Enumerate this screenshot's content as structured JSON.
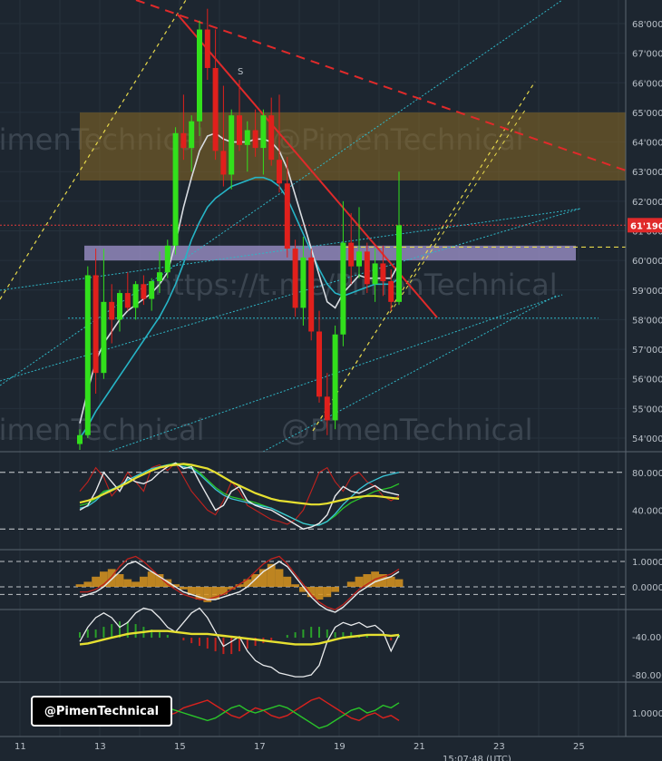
{
  "chart_data": {
    "type": "candlestick",
    "watermarks": [
      "PimenTechnical",
      "@PimenTechnical",
      "https://t.me/PimenTechnical"
    ],
    "annotation_label": "S",
    "current_price_label": "61'190",
    "price_axis": {
      "ylim": [
        53500,
        68500
      ],
      "ticks": [
        "68'000",
        "67'000",
        "66'000",
        "65'000",
        "64'000",
        "63'000",
        "62'000",
        "61'000",
        "60'000",
        "59'000",
        "58'000",
        "57'000",
        "56'000",
        "55'000",
        "54'000"
      ]
    },
    "date_axis": {
      "ticks": [
        "11",
        "13",
        "15",
        "17",
        "19",
        "21",
        "23",
        "25"
      ],
      "footer": "15:07:48 (UTC)"
    },
    "zones": [
      {
        "name": "supply",
        "from": 62700,
        "to": 65000,
        "color": "#8a6a25"
      },
      {
        "name": "support",
        "from": 60000,
        "to": 60500,
        "color": "#9a8fc6"
      }
    ],
    "candles_ohlc": [
      [
        53800,
        54300,
        53600,
        54100
      ],
      [
        54100,
        59800,
        54000,
        59500
      ],
      [
        59500,
        60400,
        55500,
        56200
      ],
      [
        56200,
        60400,
        56000,
        58600
      ],
      [
        58600,
        59200,
        57200,
        58000
      ],
      [
        58000,
        59000,
        57600,
        58900
      ],
      [
        58900,
        59600,
        58300,
        58400
      ],
      [
        58400,
        59300,
        58000,
        59200
      ],
      [
        59200,
        59500,
        58500,
        58700
      ],
      [
        58700,
        59400,
        58300,
        59300
      ],
      [
        59300,
        60300,
        58900,
        59600
      ],
      [
        59600,
        60700,
        59400,
        60500
      ],
      [
        60500,
        64500,
        60200,
        64300
      ],
      [
        64300,
        65600,
        63400,
        63800
      ],
      [
        63800,
        64900,
        63000,
        64700
      ],
      [
        64700,
        68100,
        64200,
        67800
      ],
      [
        67800,
        68500,
        66100,
        66500
      ],
      [
        66500,
        67800,
        63400,
        63700
      ],
      [
        63700,
        65900,
        62500,
        62900
      ],
      [
        62900,
        65100,
        62400,
        64900
      ],
      [
        64900,
        66100,
        63700,
        63900
      ],
      [
        63900,
        64700,
        63000,
        64400
      ],
      [
        64400,
        65100,
        63500,
        63800
      ],
      [
        63800,
        65100,
        62900,
        64900
      ],
      [
        64900,
        65500,
        63200,
        63400
      ],
      [
        63400,
        65600,
        62300,
        62600
      ],
      [
        62600,
        63500,
        60100,
        60400
      ],
      [
        60400,
        60700,
        58100,
        58400
      ],
      [
        58400,
        60800,
        57800,
        60100
      ],
      [
        60100,
        60400,
        57300,
        57600
      ],
      [
        57600,
        58300,
        55200,
        55400
      ],
      [
        55400,
        56200,
        54100,
        54600
      ],
      [
        54600,
        57800,
        54300,
        57500
      ],
      [
        57500,
        62000,
        57100,
        60600
      ],
      [
        60600,
        61600,
        59200,
        59800
      ],
      [
        59800,
        61800,
        59400,
        60300
      ],
      [
        60300,
        60600,
        58900,
        59200
      ],
      [
        59200,
        60400,
        58600,
        59900
      ],
      [
        59900,
        60500,
        58800,
        59300
      ],
      [
        59300,
        59700,
        58300,
        58600
      ],
      [
        58600,
        63000,
        58500,
        61190
      ]
    ],
    "overlays": {
      "ma_fast": [
        54500,
        55600,
        56600,
        57200,
        57600,
        58000,
        58300,
        58500,
        58700,
        58900,
        59200,
        59600,
        60600,
        61800,
        62800,
        63700,
        64200,
        64300,
        64100,
        64000,
        64000,
        64000,
        64100,
        64100,
        64000,
        63700,
        63100,
        62200,
        61300,
        60400,
        59500,
        58600,
        58400,
        58900,
        59200,
        59500,
        59400,
        59400,
        59400,
        59400,
        59900
      ],
      "ma_slow": [
        54000,
        54400,
        54900,
        55300,
        55700,
        56100,
        56500,
        56900,
        57300,
        57700,
        58100,
        58600,
        59200,
        59900,
        60700,
        61300,
        61800,
        62100,
        62300,
        62500,
        62600,
        62700,
        62800,
        62800,
        62700,
        62500,
        62100,
        61500,
        60900,
        60300,
        59700,
        59200,
        58900,
        58800,
        58900,
        59000,
        59100,
        59200,
        59200,
        59200,
        59400
      ]
    },
    "osc1": {
      "ylabel_ticks": [
        "80.000",
        "40.000"
      ],
      "levels": [
        80,
        20
      ],
      "yellow": [
        48,
        50,
        53,
        57,
        61,
        65,
        69,
        74,
        78,
        82,
        85,
        87,
        88,
        89,
        88,
        86,
        84,
        80,
        75,
        70,
        66,
        62,
        58,
        55,
        52,
        50,
        49,
        48,
        47,
        46,
        46,
        47,
        49,
        51,
        53,
        54,
        55,
        55,
        54,
        53,
        52
      ],
      "white": [
        40,
        45,
        60,
        80,
        70,
        60,
        75,
        70,
        68,
        72,
        80,
        86,
        90,
        84,
        86,
        70,
        55,
        40,
        45,
        60,
        65,
        50,
        45,
        42,
        40,
        35,
        30,
        25,
        20,
        22,
        26,
        35,
        55,
        65,
        60,
        58,
        62,
        66,
        60,
        58,
        56
      ],
      "green": [
        45,
        47,
        52,
        60,
        62,
        64,
        70,
        74,
        78,
        82,
        86,
        88,
        90,
        88,
        86,
        80,
        72,
        64,
        58,
        54,
        52,
        50,
        48,
        45,
        42,
        38,
        34,
        30,
        26,
        24,
        24,
        28,
        34,
        42,
        48,
        52,
        56,
        60,
        62,
        64,
        68
      ],
      "cyan": [
        42,
        44,
        50,
        58,
        62,
        66,
        72,
        76,
        80,
        84,
        86,
        88,
        88,
        86,
        84,
        78,
        70,
        62,
        56,
        52,
        50,
        48,
        46,
        44,
        42,
        38,
        34,
        30,
        26,
        24,
        24,
        28,
        36,
        46,
        54,
        62,
        68,
        72,
        76,
        78,
        80
      ],
      "red": [
        60,
        70,
        85,
        75,
        55,
        65,
        80,
        70,
        60,
        85,
        88,
        82,
        90,
        75,
        60,
        50,
        40,
        35,
        50,
        70,
        60,
        45,
        40,
        35,
        30,
        28,
        25,
        30,
        40,
        60,
        80,
        85,
        70,
        60,
        75,
        80,
        70,
        65,
        55,
        50,
        55
      ]
    },
    "osc2": {
      "ylabel_ticks": [
        "1.0000",
        "0.0000"
      ],
      "hist": [
        0.1,
        0.2,
        0.4,
        0.6,
        0.7,
        0.5,
        0.3,
        0.2,
        0.4,
        0.6,
        0.5,
        0.3,
        0.1,
        -0.1,
        -0.3,
        -0.5,
        -0.6,
        -0.5,
        -0.3,
        -0.1,
        0.1,
        0.3,
        0.5,
        0.7,
        0.9,
        0.7,
        0.4,
        0.1,
        -0.2,
        -0.4,
        -0.5,
        -0.4,
        -0.2,
        0.0,
        0.2,
        0.4,
        0.5,
        0.6,
        0.5,
        0.4,
        0.3
      ],
      "white": [
        -0.4,
        -0.3,
        -0.2,
        0.0,
        0.3,
        0.6,
        0.9,
        1.0,
        0.8,
        0.6,
        0.4,
        0.2,
        0.0,
        -0.2,
        -0.3,
        -0.4,
        -0.5,
        -0.5,
        -0.4,
        -0.3,
        -0.2,
        0.0,
        0.3,
        0.6,
        0.8,
        1.0,
        0.8,
        0.4,
        0.0,
        -0.4,
        -0.7,
        -0.9,
        -1.0,
        -0.8,
        -0.5,
        -0.2,
        0.0,
        0.2,
        0.3,
        0.4,
        0.6
      ],
      "red": [
        -0.2,
        -0.2,
        -0.1,
        0.1,
        0.4,
        0.8,
        1.1,
        1.2,
        1.0,
        0.7,
        0.4,
        0.1,
        -0.1,
        -0.3,
        -0.4,
        -0.5,
        -0.5,
        -0.4,
        -0.3,
        -0.1,
        0.1,
        0.3,
        0.6,
        0.9,
        1.1,
        1.2,
        0.9,
        0.5,
        0.1,
        -0.3,
        -0.6,
        -0.8,
        -0.9,
        -0.7,
        -0.4,
        -0.1,
        0.1,
        0.3,
        0.4,
        0.5,
        0.7
      ]
    },
    "osc3": {
      "ylabel_ticks": [
        "-40.000",
        "-80.000"
      ],
      "yellow": [
        -48,
        -47,
        -45,
        -43,
        -41,
        -39,
        -37,
        -36,
        -35,
        -34,
        -34,
        -34,
        -35,
        -36,
        -37,
        -37,
        -37,
        -38,
        -39,
        -40,
        -41,
        -42,
        -43,
        -44,
        -45,
        -46,
        -47,
        -48,
        -48,
        -48,
        -47,
        -45,
        -43,
        -41,
        -40,
        -39,
        -38,
        -38,
        -38,
        -39,
        -38
      ],
      "white": [
        -45,
        -30,
        -20,
        -15,
        -20,
        -30,
        -25,
        -15,
        -10,
        -12,
        -20,
        -30,
        -35,
        -25,
        -15,
        -10,
        -20,
        -35,
        -50,
        -45,
        -40,
        -55,
        -65,
        -70,
        -72,
        -78,
        -80,
        -82,
        -82,
        -80,
        -70,
        -45,
        -30,
        -25,
        -28,
        -25,
        -30,
        -28,
        -35,
        -55,
        -38
      ],
      "hist": [
        2,
        3,
        3,
        4,
        5,
        6,
        6,
        5,
        4,
        3,
        2,
        1,
        0,
        -1,
        -2,
        -3,
        -4,
        -5,
        -6,
        -6,
        -5,
        -4,
        -3,
        -2,
        -1,
        0,
        1,
        2,
        3,
        4,
        4,
        3,
        2,
        2,
        2,
        1,
        1,
        0,
        0,
        -1,
        1
      ]
    },
    "osc4": {
      "ylabel_ticks": [
        "1.0000"
      ],
      "green": [
        0.8,
        0.9,
        1.1,
        1.0,
        0.9,
        1.1,
        1.2,
        1.1,
        1.0,
        1.2,
        1.3,
        1.2,
        1.1,
        1.0,
        0.9,
        0.8,
        0.7,
        0.8,
        1.0,
        1.2,
        1.3,
        1.1,
        1.0,
        1.1,
        1.2,
        1.3,
        1.2,
        1.0,
        0.8,
        0.6,
        0.4,
        0.5,
        0.7,
        0.9,
        1.1,
        1.2,
        1.0,
        1.1,
        1.3,
        1.2,
        1.4
      ],
      "red": [
        1.2,
        1.1,
        0.9,
        1.0,
        1.2,
        1.0,
        0.9,
        0.8,
        1.0,
        0.9,
        0.8,
        0.9,
        1.0,
        1.2,
        1.3,
        1.4,
        1.5,
        1.3,
        1.1,
        0.9,
        0.8,
        1.0,
        1.2,
        1.1,
        0.9,
        0.8,
        0.9,
        1.1,
        1.3,
        1.5,
        1.6,
        1.4,
        1.2,
        1.0,
        0.8,
        0.7,
        0.9,
        1.0,
        0.8,
        0.9,
        0.7
      ]
    }
  },
  "badge": {
    "text": "@PimenTechnical"
  }
}
